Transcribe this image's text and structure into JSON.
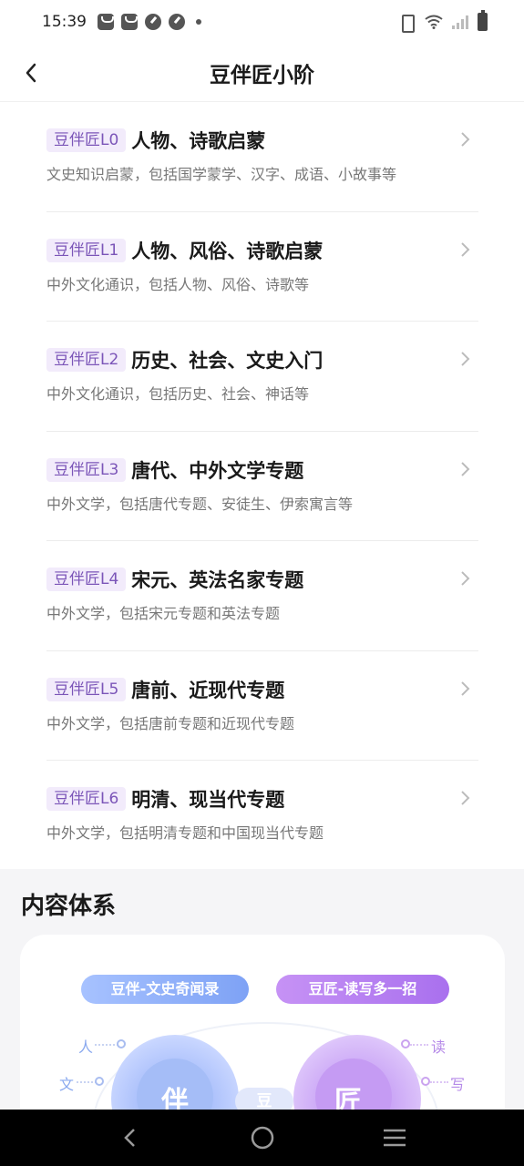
{
  "status": {
    "time": "15:39"
  },
  "header": {
    "title": "豆伴匠小阶"
  },
  "levels": [
    {
      "tag": "豆伴匠L0",
      "title": "人物、诗歌启蒙",
      "desc": "文史知识启蒙，包括国学蒙学、汉字、成语、小故事等"
    },
    {
      "tag": "豆伴匠L1",
      "title": "人物、风俗、诗歌启蒙",
      "desc": "中外文化通识，包括人物、风俗、诗歌等"
    },
    {
      "tag": "豆伴匠L2",
      "title": "历史、社会、文史入门",
      "desc": "中外文化通识，包括历史、社会、神话等"
    },
    {
      "tag": "豆伴匠L3",
      "title": "唐代、中外文学专题",
      "desc": "中外文学，包括唐代专题、安徒生、伊索寓言等"
    },
    {
      "tag": "豆伴匠L4",
      "title": "宋元、英法名家专题",
      "desc": "中外文学，包括宋元专题和英法专题"
    },
    {
      "tag": "豆伴匠L5",
      "title": "唐前、近现代专题",
      "desc": "中外文学，包括唐前专题和近现代专题"
    },
    {
      "tag": "豆伴匠L6",
      "title": "明清、现当代专题",
      "desc": "中外文学，包括明清专题和中国现当代专题"
    }
  ],
  "content_system": {
    "title": "内容体系",
    "pill_left": "豆伴-文史奇闻录",
    "pill_right": "豆匠-读写多一招",
    "label_ren": "人",
    "label_wen": "文",
    "label_du": "读",
    "label_xie": "写",
    "orb_left": "伴",
    "orb_right": "匠",
    "center": "豆"
  },
  "colors": {
    "tag_bg": "#f2ebfb",
    "tag_text": "#7b55b8",
    "pill_left": "#7ea2f5",
    "pill_right": "#a970ee"
  }
}
